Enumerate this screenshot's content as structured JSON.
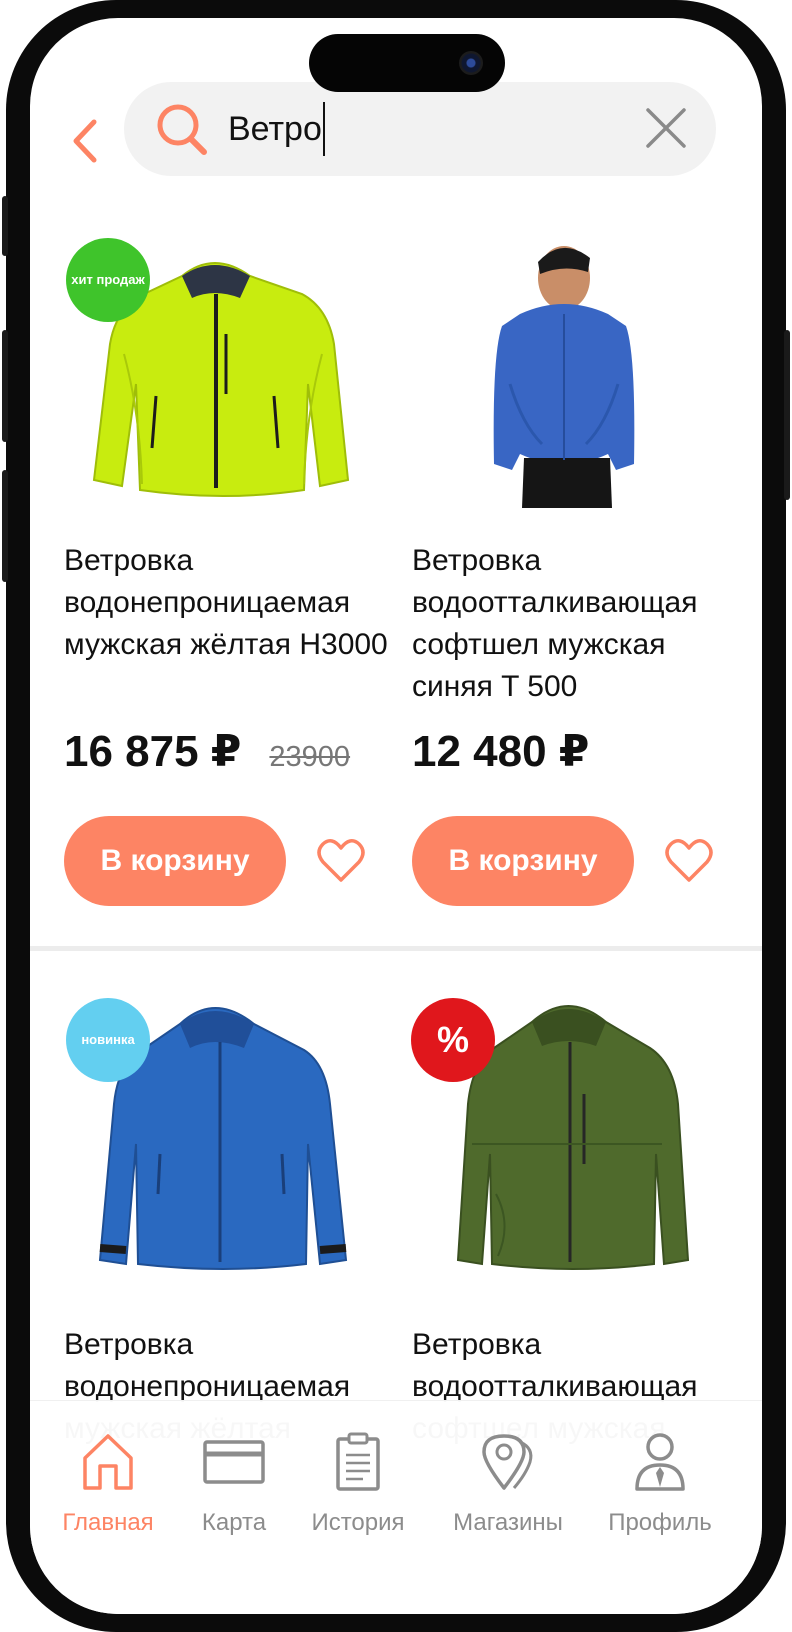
{
  "search": {
    "query": "Ветро"
  },
  "products": [
    {
      "title": "Ветровка водонепроницаемая мужская жёлтая Н3000",
      "price": "16 875 ₽",
      "old_price": "23900",
      "badge": "хит продаж",
      "cart_label": "В корзину"
    },
    {
      "title": "Ветровка водоотталкивающая софтшел мужская синяя T 500",
      "price": "12 480 ₽",
      "old_price": "",
      "badge": "",
      "cart_label": "В корзину"
    },
    {
      "title": "Ветровка водонепроницаемая мужская жёлтая",
      "badge": "новинка"
    },
    {
      "title": "Ветровка водоотталкивающая софтшел мужская",
      "badge": "%"
    }
  ],
  "nav": [
    {
      "label": "Главная",
      "icon": "home-icon",
      "active": true
    },
    {
      "label": "Карта",
      "icon": "card-icon",
      "active": false
    },
    {
      "label": "История",
      "icon": "history-icon",
      "active": false
    },
    {
      "label": "Магазины",
      "icon": "map-pin-icon",
      "active": false
    },
    {
      "label": "Профиль",
      "icon": "profile-icon",
      "active": false
    }
  ],
  "colors": {
    "accent": "#fd8464",
    "hit_badge": "#3fc42b",
    "new_badge": "#63cff0",
    "sale_badge": "#e0171c"
  }
}
